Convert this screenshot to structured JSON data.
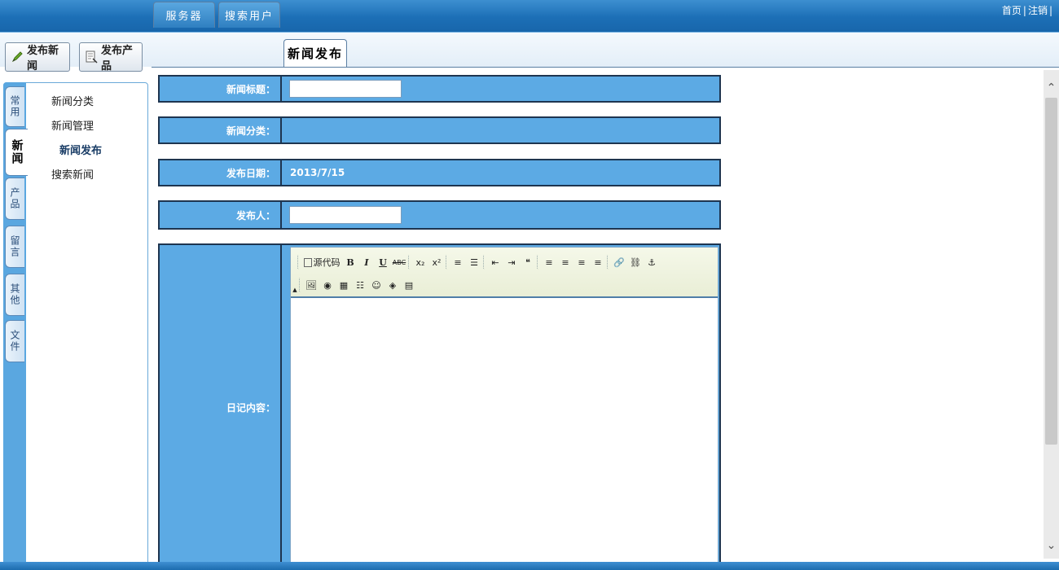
{
  "header": {
    "links": [
      "首页",
      "注销"
    ],
    "separator": "|"
  },
  "actions": {
    "publish_news": "发布新闻",
    "publish_product": "发布产品"
  },
  "sidebar": {
    "tabs": [
      "常用",
      "新闻",
      "产品",
      "留言",
      "其他",
      "文件"
    ],
    "active_tab": "新闻",
    "items": [
      "新闻分类",
      "新闻管理",
      "新闻发布",
      "搜索新闻"
    ],
    "selected_item": "新闻发布"
  },
  "content_tabs": {
    "tabs": [
      "服务器",
      "搜索用户",
      "新闻发布"
    ],
    "active": "新闻发布"
  },
  "form": {
    "title_label": "新闻标题：",
    "title_value": "",
    "category_label": "新闻分类：",
    "date_label": "发布日期：",
    "date_value": "2013/7/15",
    "publisher_label": "发布人：",
    "publisher_value": "",
    "content_label": "日记内容："
  },
  "editor": {
    "source_label": "源代码",
    "row1": [
      "B",
      "I",
      "U",
      "ABC",
      "x₂",
      "x²",
      "≡",
      "☰",
      "⇤",
      "⇥",
      "❝",
      "≡",
      "≡",
      "≡",
      "≡",
      "🔗",
      "⛓",
      "⚓"
    ],
    "row2": [
      "🖼",
      "◉",
      "▦",
      "☷",
      "☺",
      "◈",
      "▤"
    ]
  },
  "colors": {
    "header": "#1c6fb6",
    "row_bg": "#5caae4",
    "row_border": "#1e3550"
  }
}
